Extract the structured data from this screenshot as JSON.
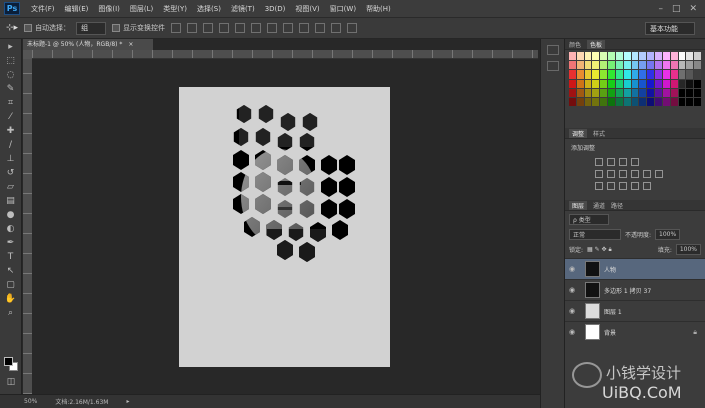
{
  "app": {
    "logo": "Ps"
  },
  "menu": [
    "文件(F)",
    "编辑(E)",
    "图像(I)",
    "图层(L)",
    "类型(Y)",
    "选择(S)",
    "滤镜(T)",
    "3D(D)",
    "视图(V)",
    "窗口(W)",
    "帮助(H)"
  ],
  "options": {
    "auto_select_label": "自动选择：",
    "auto_select_value": "组",
    "show_transform_label": "显示变换控件",
    "workspace": "基本功能"
  },
  "document": {
    "tab_title": "未标题-1 @ 50% (人物，RGB/8) *"
  },
  "status": {
    "zoom": "50%",
    "doc_size": "文档:2.16M/1.63M"
  },
  "panels": {
    "swatch_tabs": [
      "颜色",
      "色板"
    ],
    "adjust_tabs": [
      "调整",
      "样式"
    ],
    "adjust_title": "添加调整",
    "layer_tabs": [
      "图层",
      "通道",
      "路径"
    ],
    "kind_filter": "ρ 类型",
    "blend_mode": "正常",
    "opacity_label": "不透明度:",
    "opacity_value": "100%",
    "lock_label": "锁定:",
    "fill_label": "填充:",
    "fill_value": "100%",
    "layers": [
      {
        "name": "人物",
        "selected": true,
        "dark": true,
        "lock": false
      },
      {
        "name": "多边形 1 拷贝 37",
        "selected": false,
        "dark": true,
        "lock": false
      },
      {
        "name": "图层 1",
        "selected": false,
        "dark": false,
        "lock": false
      },
      {
        "name": "背景",
        "selected": false,
        "dark": false,
        "lock": true
      }
    ]
  },
  "watermark": {
    "text": "小钱学设计",
    "url": "UiBQ.CoM"
  }
}
